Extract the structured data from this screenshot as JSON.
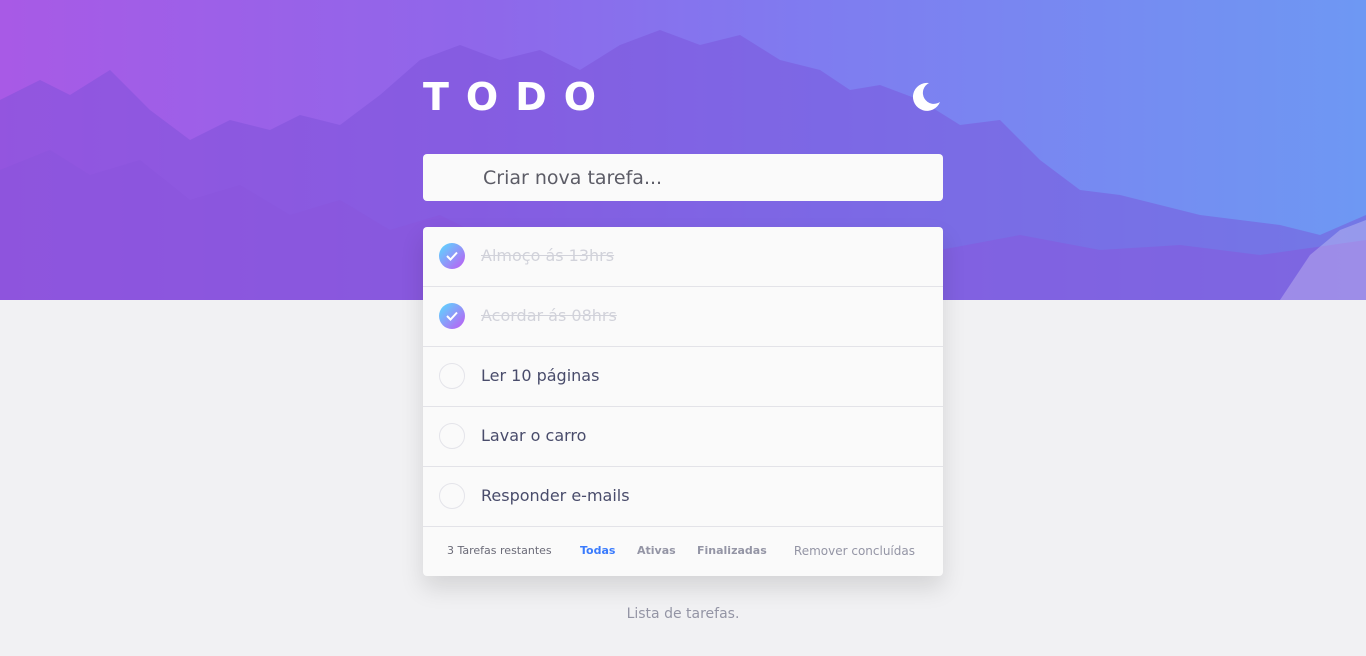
{
  "app": {
    "title": "TODO"
  },
  "theme_toggle": {
    "icon": "moon-icon"
  },
  "new_task": {
    "placeholder": "Criar nova tarefa..."
  },
  "tasks": [
    {
      "text": "Almoço ás 13hrs",
      "completed": true
    },
    {
      "text": "Acordar ás 08hrs",
      "completed": true
    },
    {
      "text": "Ler 10 páginas",
      "completed": false
    },
    {
      "text": "Lavar o carro",
      "completed": false
    },
    {
      "text": "Responder e-mails",
      "completed": false
    }
  ],
  "footer": {
    "remaining": "3 Tarefas restantes",
    "filter_all": "Todas",
    "filter_active": "Ativas",
    "filter_completed": "Finalizadas",
    "clear_completed": "Remover concluídas"
  },
  "caption": "Lista de tarefas.",
  "colors": {
    "accent": "#3a7bfd",
    "check_gradient_start": "#57ddff",
    "check_gradient_end": "#c058f3"
  }
}
